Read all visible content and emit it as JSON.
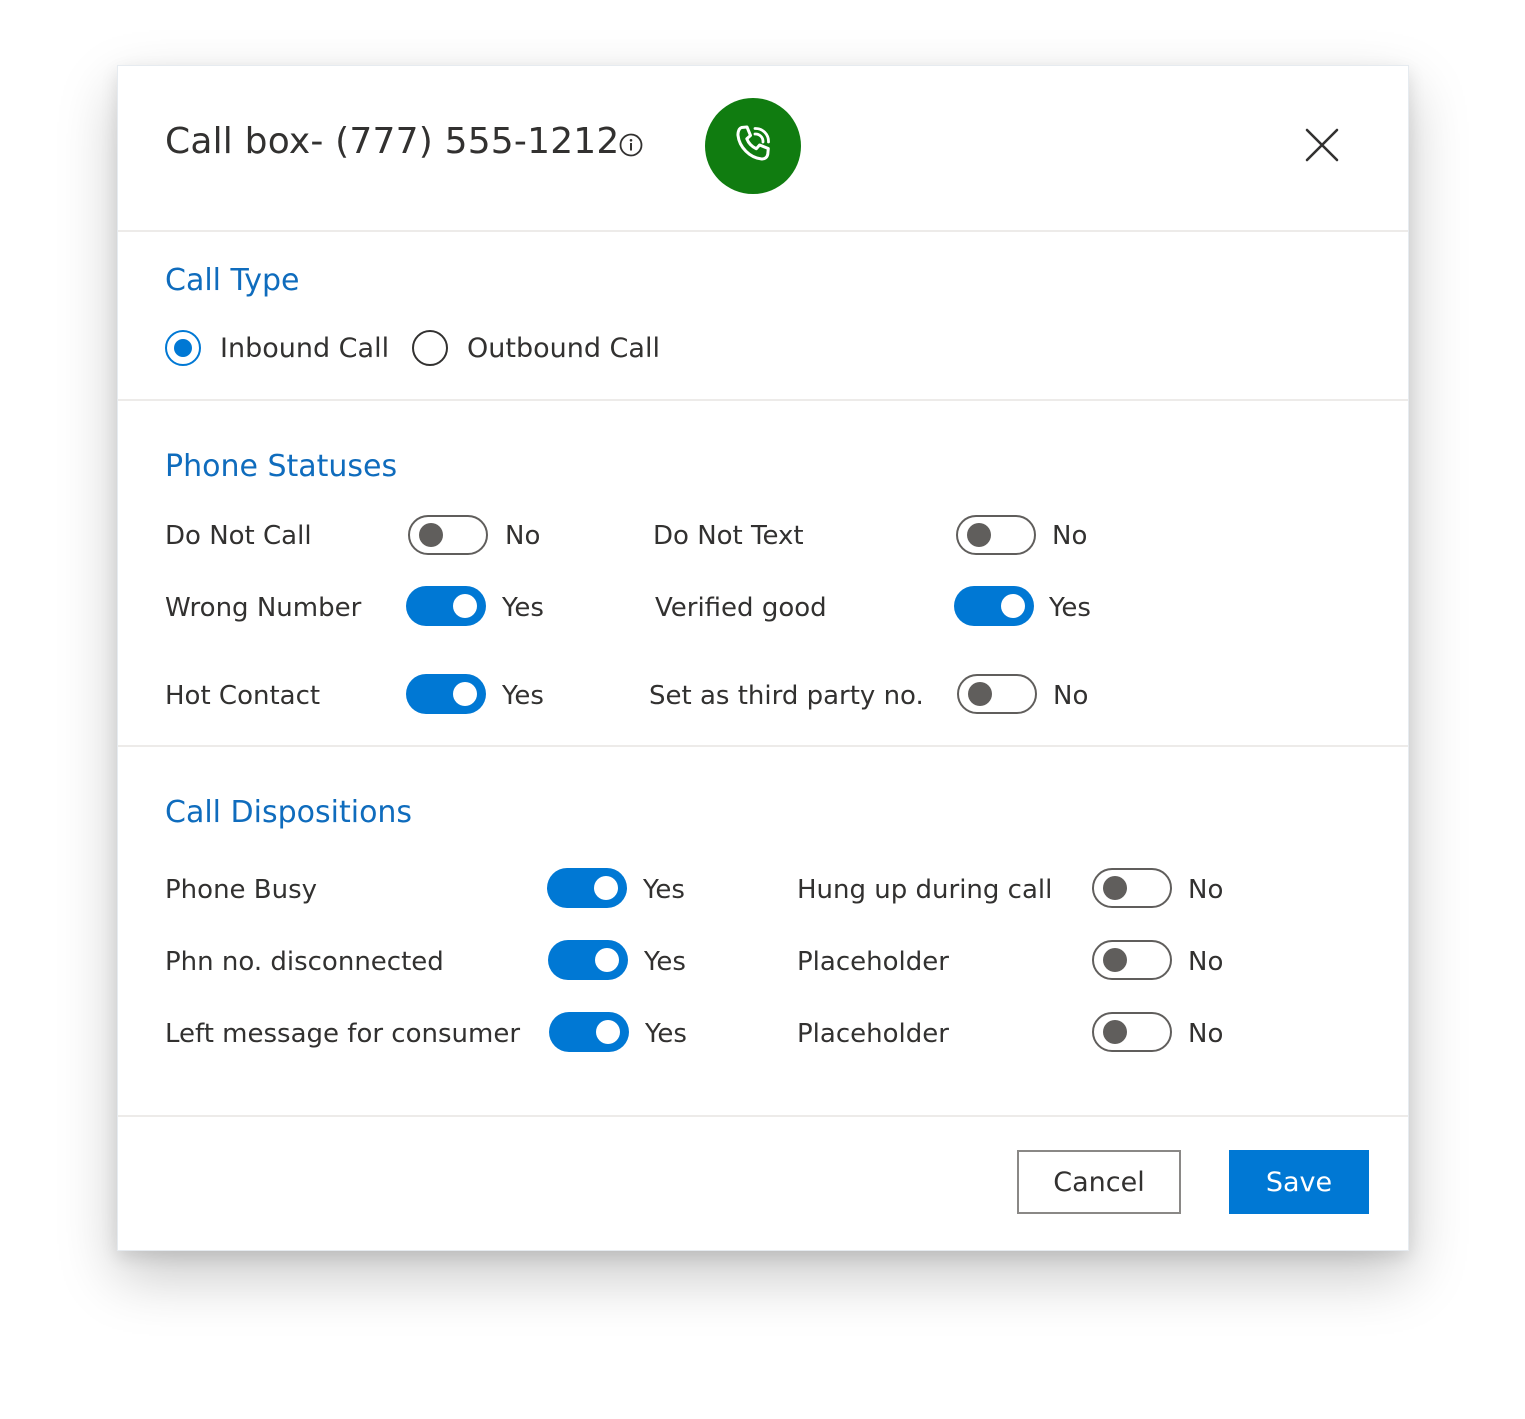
{
  "dialog": {
    "title": "Call box- (777) 555-1212",
    "info_icon": "info-icon",
    "call_icon": "phone-call-icon",
    "close_icon": "close-icon"
  },
  "call_type": {
    "title": "Call Type",
    "options": [
      {
        "label": "Inbound Call",
        "checked": true
      },
      {
        "label": "Outbound Call",
        "checked": false
      }
    ]
  },
  "phone_statuses": {
    "title": "Phone Statuses",
    "items": [
      {
        "label": "Do Not Call",
        "on": false,
        "state": "No"
      },
      {
        "label": "Do Not Text",
        "on": false,
        "state": "No"
      },
      {
        "label": "Wrong Number",
        "on": true,
        "state": "Yes"
      },
      {
        "label": "Verified good",
        "on": true,
        "state": "Yes"
      },
      {
        "label": "Hot Contact",
        "on": true,
        "state": "Yes"
      },
      {
        "label": "Set as third party no.",
        "on": false,
        "state": "No"
      }
    ]
  },
  "call_dispositions": {
    "title": "Call Dispositions",
    "items": [
      {
        "label": "Phone Busy",
        "on": true,
        "state": "Yes"
      },
      {
        "label": "Hung up during call",
        "on": false,
        "state": "No"
      },
      {
        "label": "Phn no. disconnected",
        "on": true,
        "state": "Yes"
      },
      {
        "label": "Placeholder",
        "on": false,
        "state": "No"
      },
      {
        "label": "Left message for consumer",
        "on": true,
        "state": "Yes"
      },
      {
        "label": "Placeholder",
        "on": false,
        "state": "No"
      }
    ]
  },
  "footer": {
    "cancel_label": "Cancel",
    "save_label": "Save"
  },
  "colors": {
    "accent": "#0078d4",
    "section_title": "#0f6cbd",
    "call_button": "#107c10"
  }
}
